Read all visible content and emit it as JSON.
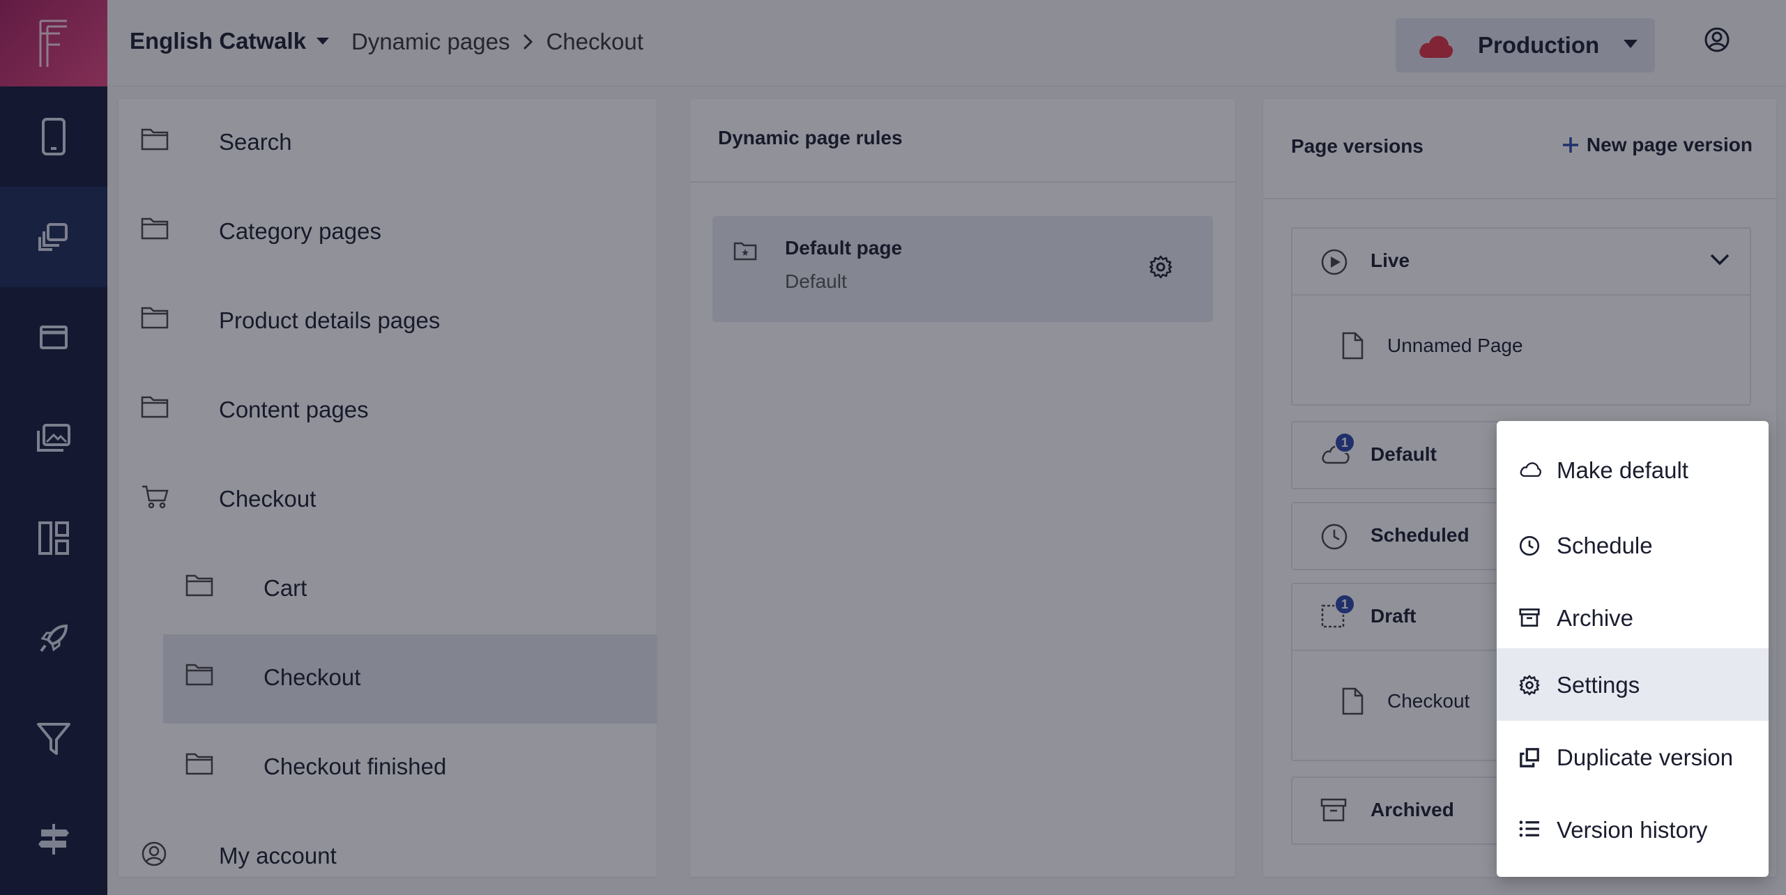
{
  "header": {
    "project": "English Catwalk",
    "breadcrumb": [
      "Dynamic pages",
      "Checkout"
    ],
    "environment": "Production",
    "brand_color": "#e2437d"
  },
  "rail": {
    "items": [
      "phone-icon",
      "pages-icon",
      "window-icon",
      "images-icon",
      "layout-icon",
      "rocket-icon",
      "filter-icon",
      "signpost-icon"
    ],
    "active": "pages-icon"
  },
  "tree": {
    "items": [
      {
        "label": "Search",
        "icon": "folder-icon",
        "level": 0
      },
      {
        "label": "Category pages",
        "icon": "folder-icon",
        "level": 0
      },
      {
        "label": "Product details pages",
        "icon": "folder-icon",
        "level": 0
      },
      {
        "label": "Content pages",
        "icon": "folder-icon",
        "level": 0
      },
      {
        "label": "Checkout",
        "icon": "cart-icon",
        "level": 0
      },
      {
        "label": "Cart",
        "icon": "folder-icon",
        "level": 1
      },
      {
        "label": "Checkout",
        "icon": "folder-icon",
        "level": 1,
        "selected": true
      },
      {
        "label": "Checkout finished",
        "icon": "folder-icon",
        "level": 1
      },
      {
        "label": "My account",
        "icon": "user-circle-icon",
        "level": 0
      }
    ]
  },
  "rules": {
    "title": "Dynamic page rules",
    "card": {
      "title": "Default page",
      "subtitle": "Default"
    }
  },
  "versions": {
    "title": "Page versions",
    "new_label": "New page version",
    "live": {
      "label": "Live",
      "page": "Unnamed Page"
    },
    "default": {
      "label": "Default",
      "count": "1"
    },
    "scheduled": {
      "label": "Scheduled"
    },
    "draft": {
      "label": "Draft",
      "count": "1",
      "page": "Checkout"
    },
    "archived": {
      "label": "Archived"
    }
  },
  "menu": {
    "items": [
      "Make default",
      "Schedule",
      "Archive",
      "Settings",
      "Duplicate version",
      "Version history"
    ],
    "focused": "Make default",
    "hovered": "Settings"
  }
}
